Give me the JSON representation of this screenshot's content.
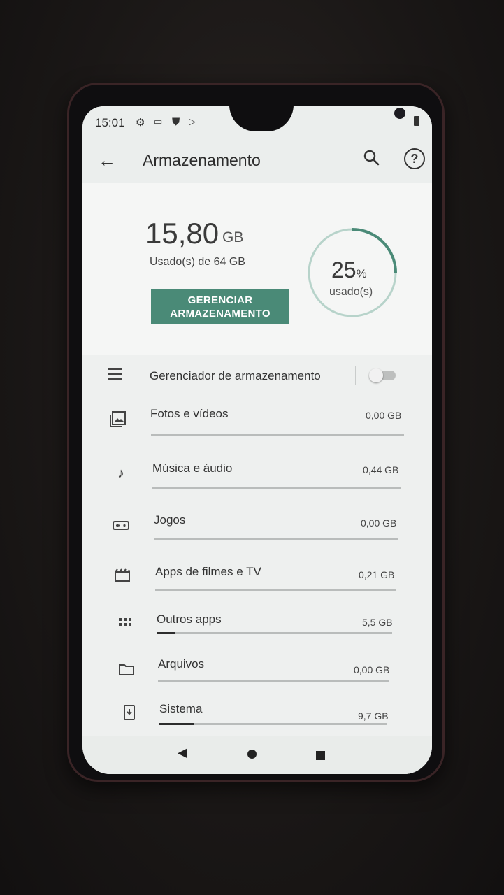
{
  "status_bar": {
    "time": "15:01",
    "icons": [
      "gear-icon",
      "cast-icon",
      "shield-icon",
      "play-store-icon",
      "battery-icon"
    ]
  },
  "app_bar": {
    "title": "Armazenamento",
    "back_icon": "arrow-left-icon",
    "search_icon": "search-icon",
    "help_label": "?"
  },
  "summary": {
    "used_value": "15,80",
    "used_unit": "GB",
    "used_of": "Usado(s) de 64 GB",
    "manage_button": "GERENCIAR ARMAZENAMENTO",
    "percent_value": "25",
    "percent_sign": "%",
    "percent_label": "usado(s)",
    "percent_fraction": 0.25,
    "accent_color": "#4a8a77"
  },
  "storage_manager": {
    "label": "Gerenciador de armazenamento",
    "enabled": false
  },
  "categories": [
    {
      "label": "Fotos e vídeos",
      "size": "0,00 GB",
      "icon": "photo-icon",
      "fill": 0.0
    },
    {
      "label": "Música e áudio",
      "size": "0,44 GB",
      "icon": "music-note-icon",
      "fill": 0.0
    },
    {
      "label": "Jogos",
      "size": "0,00 GB",
      "icon": "gamepad-icon",
      "fill": 0.0
    },
    {
      "label": "Apps de filmes e TV",
      "size": "0,21 GB",
      "icon": "movie-icon",
      "fill": 0.0
    },
    {
      "label": "Outros apps",
      "size": "5,5 GB",
      "icon": "apps-grid-icon",
      "fill": 0.08
    },
    {
      "label": "Arquivos",
      "size": "0,00 GB",
      "icon": "folder-icon",
      "fill": 0.0
    },
    {
      "label": "Sistema",
      "size": "9,7 GB",
      "icon": "system-icon",
      "fill": 0.15
    }
  ],
  "nav_bar": {
    "icons": [
      "nav-back-icon",
      "nav-home-icon",
      "nav-recents-icon"
    ]
  }
}
